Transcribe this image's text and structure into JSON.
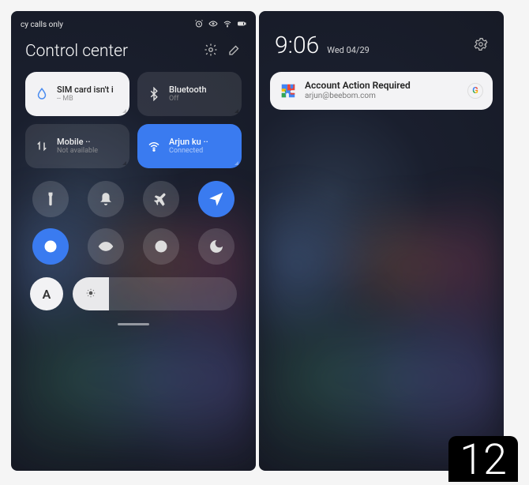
{
  "left": {
    "status_left": "cy calls only",
    "title": "Control center",
    "tiles": {
      "sim": {
        "title": "SIM card isn't i",
        "sub": "-- MB"
      },
      "bluetooth": {
        "title": "Bluetooth",
        "sub": "Off"
      },
      "mobile": {
        "title": "Mobile ··",
        "sub": "Not available"
      },
      "wifi": {
        "title": "Arjun ku ··",
        "sub": "Connected"
      }
    },
    "auto_label": "A"
  },
  "right": {
    "time": "9:06",
    "date": "Wed 04/29",
    "notif": {
      "title": "Account Action Required",
      "sub": "arjun@beebom.com"
    }
  },
  "badge": "12"
}
